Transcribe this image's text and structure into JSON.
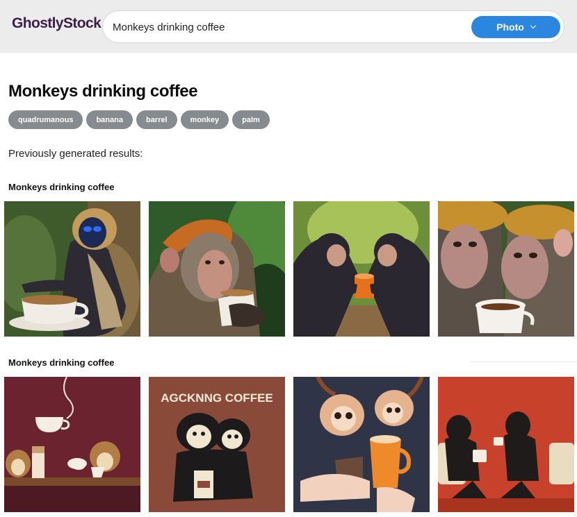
{
  "header": {
    "logo": "GhostlyStock",
    "search_value": "Monkeys drinking coffee",
    "type_label": "Photo"
  },
  "page": {
    "title": "Monkeys drinking coffee",
    "tags": [
      "quadrumanous",
      "banana",
      "barrel",
      "monkey",
      "palm"
    ],
    "previously_label": "Previously generated results:"
  },
  "sections": [
    {
      "title": "Monkeys drinking coffee"
    },
    {
      "title": "Monkeys drinking coffee"
    }
  ],
  "illustration_text": {
    "coffee_poster": "AGCKNNG COFFEE"
  },
  "colors": {
    "brand": "#3b1f49",
    "accent": "#2a86df",
    "tag_bg": "#868b8f",
    "topbar_bg": "#ececec"
  }
}
